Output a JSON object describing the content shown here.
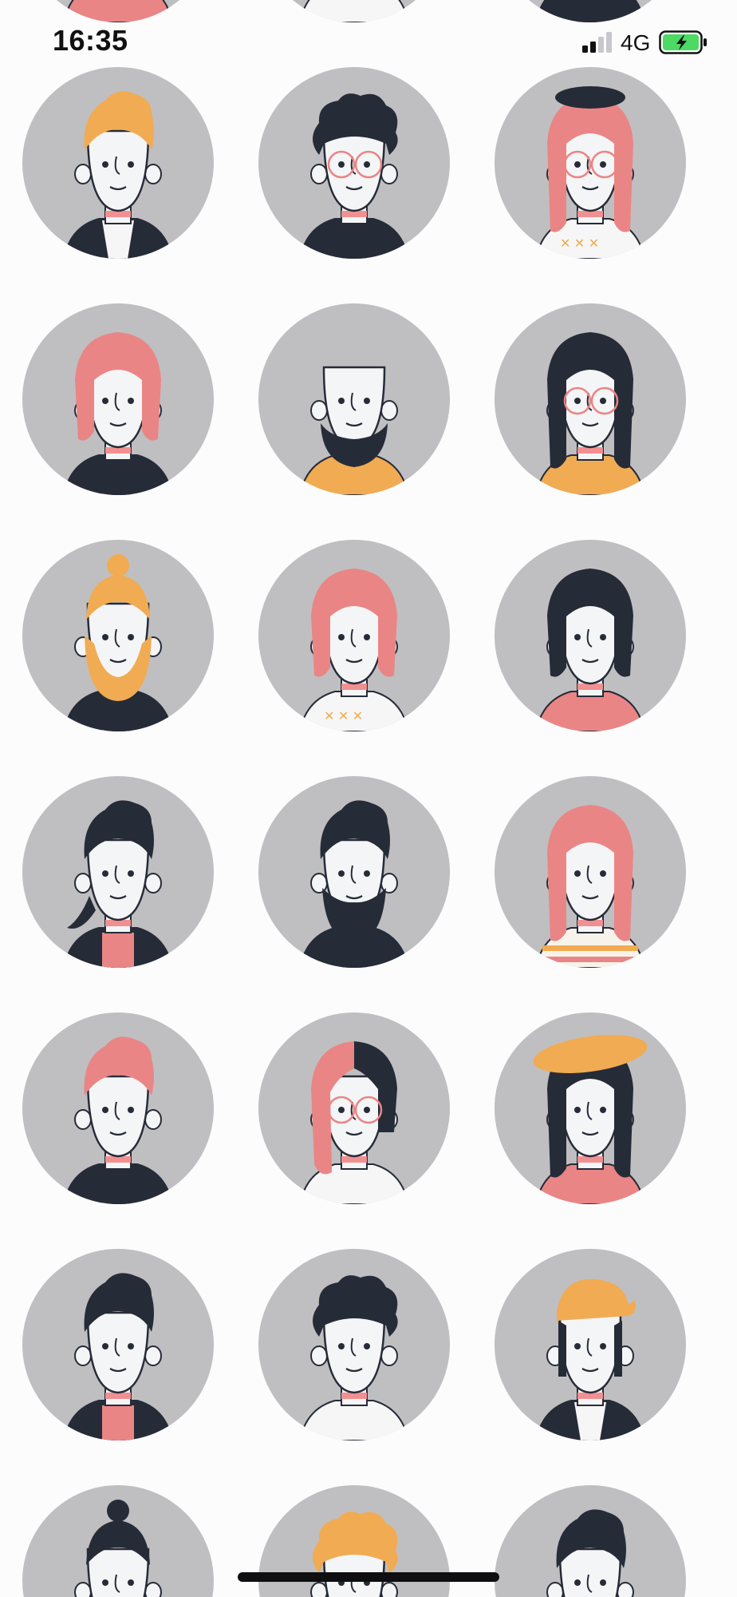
{
  "status_bar": {
    "time": "16:35",
    "network": "4G",
    "signal_icon": "cellular-signal-icon",
    "battery_icon": "battery-charging-icon",
    "battery_color": "#4cd964"
  },
  "palette": {
    "background": "#fcfcfd",
    "circle": "#bfbfc1",
    "skin": "#f4f5f6",
    "dark": "#262b38",
    "pink": "#ea8585",
    "orange": "#f1ab52",
    "neck": "#f19091"
  },
  "avatars": [
    {
      "name": "avatar-partial-1",
      "hair": "pink-short",
      "shirt": "pink"
    },
    {
      "name": "avatar-partial-2",
      "hair": "none",
      "shirt": "white-collar"
    },
    {
      "name": "avatar-partial-3",
      "hair": "none",
      "shirt": "dark"
    },
    {
      "name": "avatar-orange-hair-boy",
      "hair": "orange-quiff",
      "shirt": "dark-vest"
    },
    {
      "name": "avatar-curly-glasses-man",
      "hair": "dark-curly",
      "shirt": "dark"
    },
    {
      "name": "avatar-beret-glasses-woman",
      "hair": "pink-long-beret",
      "shirt": "white-pattern"
    },
    {
      "name": "avatar-pink-hair-mustache",
      "hair": "pink-bob",
      "shirt": "dark"
    },
    {
      "name": "avatar-bald-bearded-man",
      "hair": "bald-beard",
      "shirt": "orange-polo"
    },
    {
      "name": "avatar-dark-hair-glasses-woman",
      "hair": "dark-long",
      "shirt": "orange-top"
    },
    {
      "name": "avatar-orange-bun-beard",
      "hair": "orange-bun-beard",
      "shirt": "dark"
    },
    {
      "name": "avatar-pink-bob-woman",
      "hair": "pink-wide",
      "shirt": "white-pattern"
    },
    {
      "name": "avatar-dark-bob-woman",
      "hair": "dark-bob",
      "shirt": "pink-cardigan"
    },
    {
      "name": "avatar-ponytail-goatee-man",
      "hair": "dark-ponytail",
      "shirt": "dark-pink"
    },
    {
      "name": "avatar-dark-beard-man",
      "hair": "dark-quiff-beard",
      "shirt": "dark"
    },
    {
      "name": "avatar-pink-long-woman",
      "hair": "pink-long",
      "shirt": "striped"
    },
    {
      "name": "avatar-pink-quiff-man",
      "hair": "pink-quiff",
      "shirt": "dark-necklace"
    },
    {
      "name": "avatar-half-pink-glasses",
      "hair": "pink-dark-split",
      "shirt": "white"
    },
    {
      "name": "avatar-orange-hat-woman",
      "hair": "dark-long-hat",
      "shirt": "pink-top"
    },
    {
      "name": "avatar-dark-spiky-boy",
      "hair": "dark-spiky",
      "shirt": "dark-pink"
    },
    {
      "name": "avatar-curly-side-woman",
      "hair": "dark-curly-side",
      "shirt": "white-tee"
    },
    {
      "name": "avatar-orange-cap-man",
      "hair": "orange-cap",
      "shirt": "dark-vest"
    },
    {
      "name": "avatar-dark-bun-partial",
      "hair": "dark-bun",
      "shirt": "dark"
    },
    {
      "name": "avatar-orange-curly-partial",
      "hair": "orange-curly",
      "shirt": "dark"
    },
    {
      "name": "avatar-dark-hair-partial",
      "hair": "dark-beard-partial",
      "shirt": "dark"
    }
  ]
}
